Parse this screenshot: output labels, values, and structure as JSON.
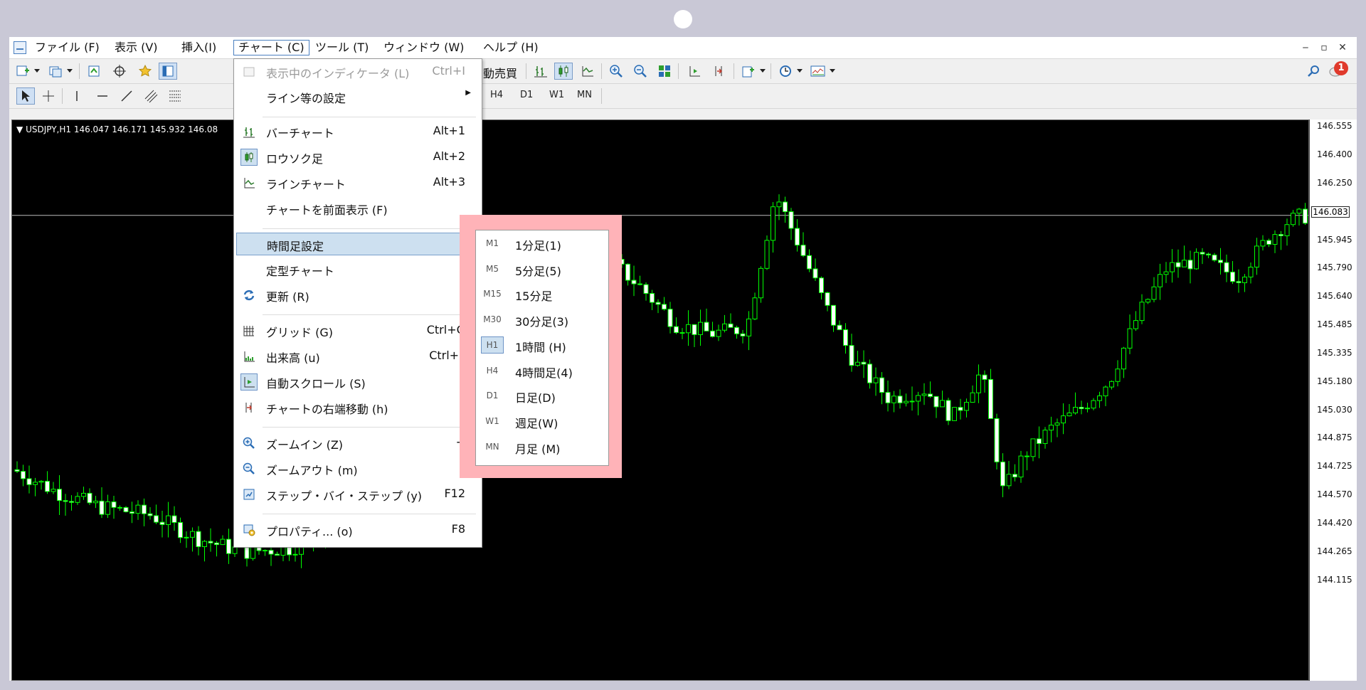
{
  "menubar": {
    "items": [
      "ファイル (F)",
      "表示 (V)",
      "挿入(I)",
      "チャート (C)",
      "ツール (T)",
      "ウィンドウ (W)",
      "ヘルプ (H)"
    ],
    "window_controls": [
      "‒",
      "▫",
      "✕"
    ]
  },
  "toolbar": {
    "visible_text": "動売買",
    "timeframes": [
      "H4",
      "D1",
      "W1",
      "MN"
    ],
    "notification_count": "1"
  },
  "chart": {
    "header": "USDJPY,H1  146.047 146.171 145.932 146.08",
    "current_price": "146.083",
    "price_labels": [
      "146.555",
      "146.400",
      "146.250",
      "145.945",
      "145.790",
      "145.640",
      "145.485",
      "145.335",
      "145.180",
      "145.030",
      "144.875",
      "144.725",
      "144.570",
      "144.420",
      "144.265",
      "144.115"
    ],
    "candle_color": "#00ff00",
    "background": "#000000"
  },
  "dropdown": {
    "items": [
      {
        "label": "表示中のインディケータ (L)",
        "shortcut": "Ctrl+I",
        "disabled": true,
        "icon": "indicator-list-icon"
      },
      {
        "label": "ライン等の設定",
        "submenu": true
      },
      {
        "label": "バーチャート",
        "shortcut": "Alt+1",
        "icon": "bar-chart-icon"
      },
      {
        "label": "ロウソク足",
        "shortcut": "Alt+2",
        "icon": "candlestick-icon",
        "checked": true
      },
      {
        "label": "ラインチャート",
        "shortcut": "Alt+3",
        "icon": "line-chart-icon"
      },
      {
        "label": "チャートを前面表示 (F)"
      },
      {
        "label": "時間足設定",
        "submenu": true,
        "highlighted": true
      },
      {
        "label": "定型チャート",
        "submenu": true
      },
      {
        "label": "更新 (R)",
        "icon": "refresh-icon"
      },
      {
        "label": "グリッド (G)",
        "shortcut": "Ctrl+G",
        "icon": "grid-icon"
      },
      {
        "label": "出来高 (u)",
        "shortcut": "Ctrl+L",
        "icon": "volume-icon"
      },
      {
        "label": "自動スクロール (S)",
        "icon": "auto-scroll-icon",
        "checked": true
      },
      {
        "label": "チャートの右端移動 (h)",
        "icon": "chart-shift-icon"
      },
      {
        "label": "ズームイン (Z)",
        "shortcut": "+",
        "icon": "zoom-in-icon"
      },
      {
        "label": "ズームアウト (m)",
        "shortcut": "-",
        "icon": "zoom-out-icon"
      },
      {
        "label": "ステップ・バイ・ステップ (y)",
        "shortcut": "F12",
        "icon": "step-icon"
      },
      {
        "label": "プロパティ... (o)",
        "shortcut": "F8",
        "icon": "properties-icon"
      }
    ]
  },
  "submenu": {
    "items": [
      {
        "code": "M1",
        "label": "1分足(1)"
      },
      {
        "code": "M5",
        "label": "5分足(5)"
      },
      {
        "code": "M15",
        "label": "15分足"
      },
      {
        "code": "M30",
        "label": "30分足(3)"
      },
      {
        "code": "H1",
        "label": "1時間 (H)",
        "checked": true
      },
      {
        "code": "H4",
        "label": "4時間足(4)"
      },
      {
        "code": "D1",
        "label": "日足(D)"
      },
      {
        "code": "W1",
        "label": "週足(W)"
      },
      {
        "code": "MN",
        "label": "月足 (M)"
      }
    ]
  }
}
